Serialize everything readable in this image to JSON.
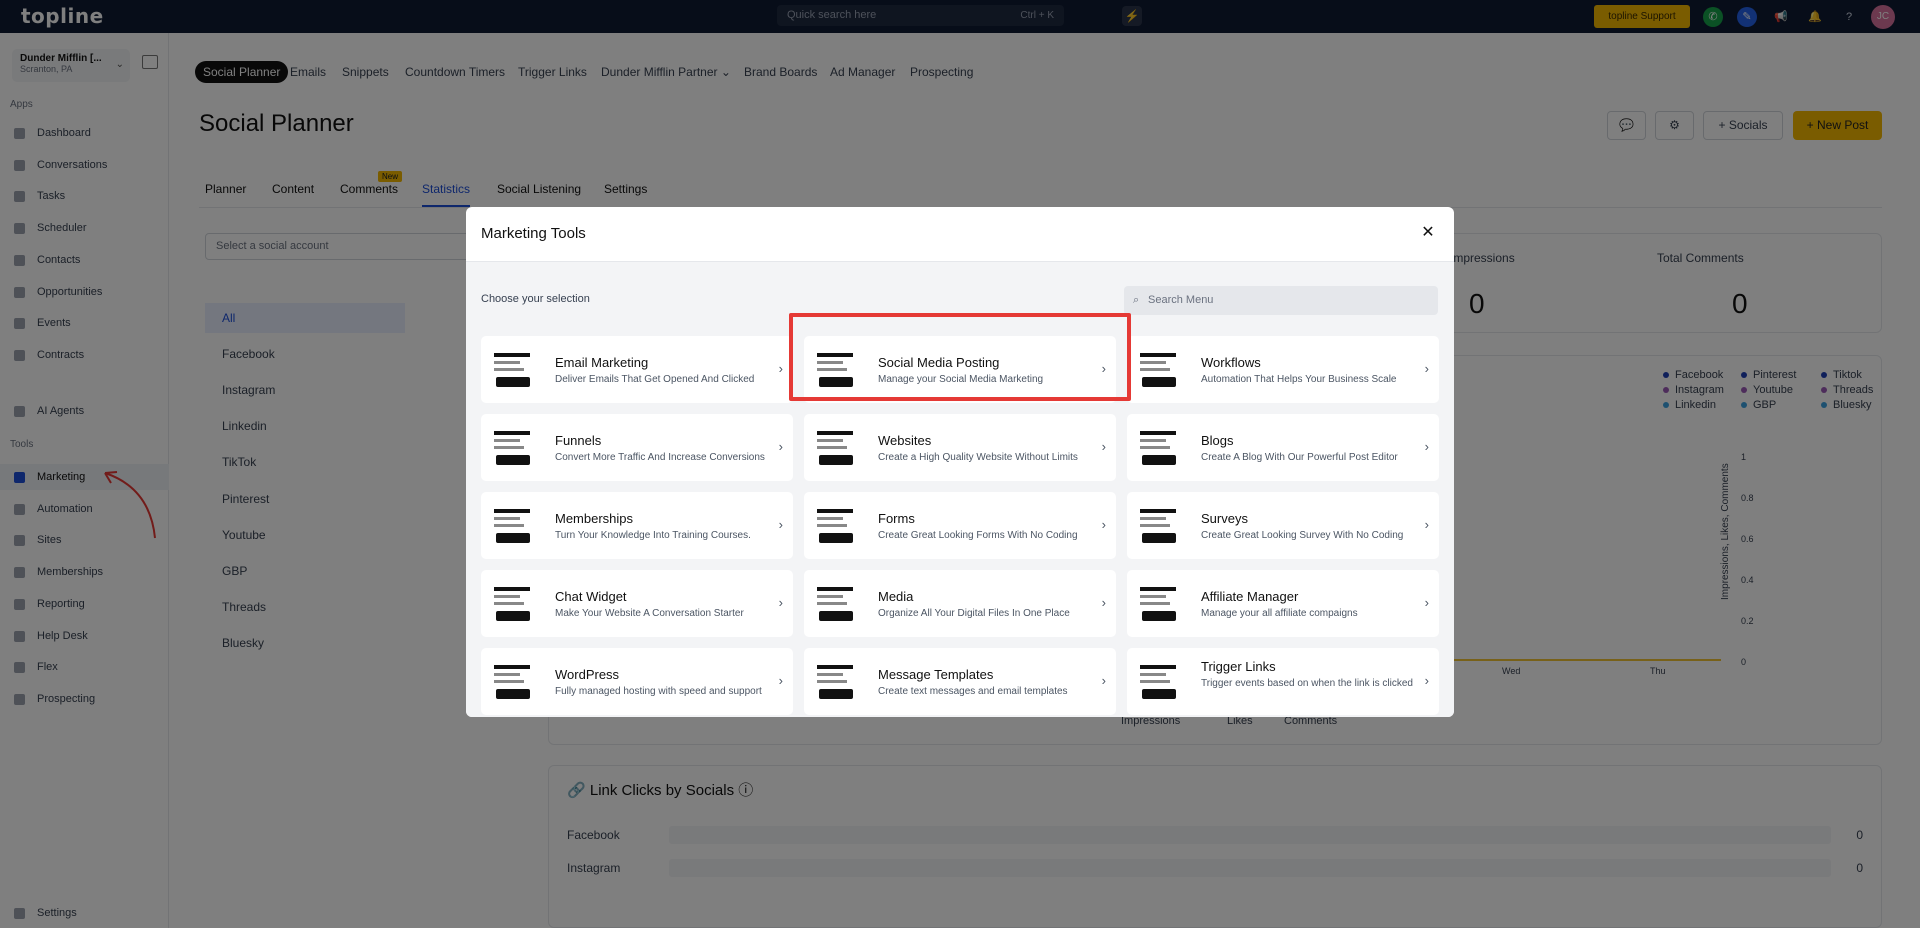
{
  "topbar": {
    "logo": "topline",
    "search_placeholder": "Quick search here",
    "search_shortcut": "Ctrl + K",
    "support_label": "topline Support",
    "avatar_initials": "JC"
  },
  "account": {
    "name": "Dunder Mifflin [...",
    "location": "Scranton, PA"
  },
  "sidebar": {
    "apps_label": "Apps",
    "tools_label": "Tools",
    "apps": [
      {
        "label": "Dashboard",
        "icon": "dashboard-icon"
      },
      {
        "label": "Conversations",
        "icon": "chat-icon"
      },
      {
        "label": "Tasks",
        "icon": "task-icon"
      },
      {
        "label": "Scheduler",
        "icon": "calendar-icon"
      },
      {
        "label": "Contacts",
        "icon": "user-icon"
      },
      {
        "label": "Opportunities",
        "icon": "target-icon"
      },
      {
        "label": "Events",
        "icon": "event-icon"
      },
      {
        "label": "Contracts",
        "icon": "contract-icon"
      }
    ],
    "ai_agents": "AI Agents",
    "tools": [
      {
        "label": "Marketing",
        "icon": "megaphone-icon"
      },
      {
        "label": "Automation",
        "icon": "automation-icon"
      },
      {
        "label": "Sites",
        "icon": "sites-icon"
      },
      {
        "label": "Memberships",
        "icon": "memberships-icon"
      },
      {
        "label": "Reporting",
        "icon": "reporting-icon"
      },
      {
        "label": "Help Desk",
        "icon": "help-desk-icon"
      },
      {
        "label": "Flex",
        "icon": "flex-icon"
      },
      {
        "label": "Prospecting",
        "icon": "prospecting-icon"
      }
    ],
    "settings": "Settings"
  },
  "subnav": [
    "Social Planner",
    "Emails",
    "Snippets",
    "Countdown Timers",
    "Trigger Links",
    "Dunder Mifflin Partner",
    "Brand Boards",
    "Ad Manager",
    "Prospecting"
  ],
  "page": {
    "title": "Social Planner",
    "socials_button": "Socials",
    "new_post_button": "New Post",
    "tabs": [
      "Planner",
      "Content",
      "Comments",
      "Statistics",
      "Social Listening",
      "Settings"
    ],
    "new_badge": "New",
    "select_account_placeholder": "Select a social account",
    "socials": [
      "All",
      "Facebook",
      "Instagram",
      "Linkedin",
      "TikTok",
      "Pinterest",
      "Youtube",
      "GBP",
      "Threads",
      "Bluesky"
    ],
    "stats": [
      {
        "label": "Impressions",
        "value": "0"
      },
      {
        "label": "Total Comments",
        "value": "0"
      }
    ],
    "legend": [
      "Facebook",
      "Pinterest",
      "Tiktok",
      "Instagram",
      "Youtube",
      "Threads",
      "Linkedin",
      "GBP",
      "Bluesky"
    ],
    "y_ticks": [
      "1",
      "0.8",
      "0.6",
      "0.4",
      "0.2",
      "0"
    ],
    "x_ticks": [
      "Wed",
      "Thu"
    ],
    "y_axis_label": "Impressions, Likes, Comments",
    "series_legend": [
      "Impressions",
      "Likes",
      "Comments"
    ],
    "link_clicks_title": "Link Clicks by Socials",
    "link_clicks": [
      {
        "label": "Facebook",
        "value": "0"
      },
      {
        "label": "Instagram",
        "value": "0"
      }
    ]
  },
  "modal": {
    "title": "Marketing Tools",
    "choose_label": "Choose your selection",
    "search_placeholder": "Search Menu",
    "tools": [
      {
        "name": "Email Marketing",
        "desc": "Deliver Emails That Get Opened And Clicked",
        "icon": "email-marketing-icon"
      },
      {
        "name": "Social Media Posting",
        "desc": "Manage your Social Media Marketing",
        "icon": "social-media-icon"
      },
      {
        "name": "Workflows",
        "desc": "Automation That Helps Your Business Scale",
        "icon": "workflows-icon"
      },
      {
        "name": "Funnels",
        "desc": "Convert More Traffic And Increase Conversions",
        "icon": "funnels-icon"
      },
      {
        "name": "Websites",
        "desc": "Create a High Quality Website Without Limits",
        "icon": "websites-icon"
      },
      {
        "name": "Blogs",
        "desc": "Create A Blog With Our Powerful Post Editor",
        "icon": "blogs-icon"
      },
      {
        "name": "Memberships",
        "desc": "Turn Your Knowledge Into Training Courses.",
        "icon": "memberships-icon"
      },
      {
        "name": "Forms",
        "desc": "Create Great Looking Forms With No Coding",
        "icon": "forms-icon"
      },
      {
        "name": "Surveys",
        "desc": "Create Great Looking Survey With No Coding",
        "icon": "surveys-icon"
      },
      {
        "name": "Chat Widget",
        "desc": "Make Your Website A Conversation Starter",
        "icon": "chat-widget-icon"
      },
      {
        "name": "Media",
        "desc": "Organize All Your Digital Files In One Place",
        "icon": "media-icon"
      },
      {
        "name": "Affiliate Manager",
        "desc": "Manage your all affiliate compaigns",
        "icon": "affiliate-icon"
      },
      {
        "name": "WordPress",
        "desc": "Fully managed hosting with speed and support",
        "icon": "wordpress-icon"
      },
      {
        "name": "Message Templates",
        "desc": "Create text messages and email templates",
        "icon": "message-templates-icon"
      },
      {
        "name": "Trigger Links",
        "desc": "Trigger events based on when the link is clicked",
        "icon": "trigger-links-icon"
      }
    ]
  },
  "colors": {
    "topbar": "#0f1b33",
    "accent": "#f5b800",
    "highlight": "#e53935",
    "active_tab": "#1d4ed8"
  }
}
